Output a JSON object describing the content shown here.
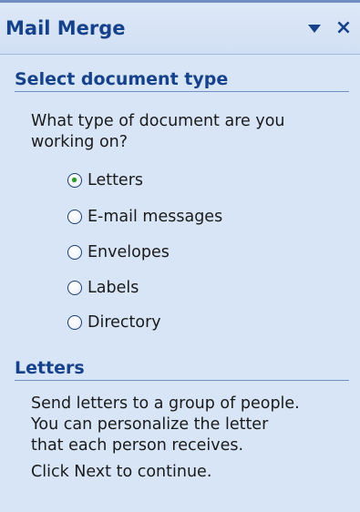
{
  "pane": {
    "title": "Mail Merge",
    "dropdown_icon": "triangle-down-icon",
    "close_label": "×"
  },
  "section_type": {
    "heading": "Select document type",
    "question_line1": "What type of document are you",
    "question_line2": "working on?",
    "options": [
      {
        "label": "Letters",
        "selected": true
      },
      {
        "label": "E-mail messages",
        "selected": false
      },
      {
        "label": "Envelopes",
        "selected": false
      },
      {
        "label": "Labels",
        "selected": false
      },
      {
        "label": "Directory",
        "selected": false
      }
    ]
  },
  "section_info": {
    "heading": "Letters",
    "description_line1": "Send letters to a group of people.",
    "description_line2": "You can personalize the letter",
    "description_line3": "that each person receives.",
    "continue_text": "Click Next to continue."
  },
  "colors": {
    "pane_background": "#d8e5f6",
    "heading_text": "#15428b",
    "selected_radio_dot": "#2a9e2a"
  }
}
